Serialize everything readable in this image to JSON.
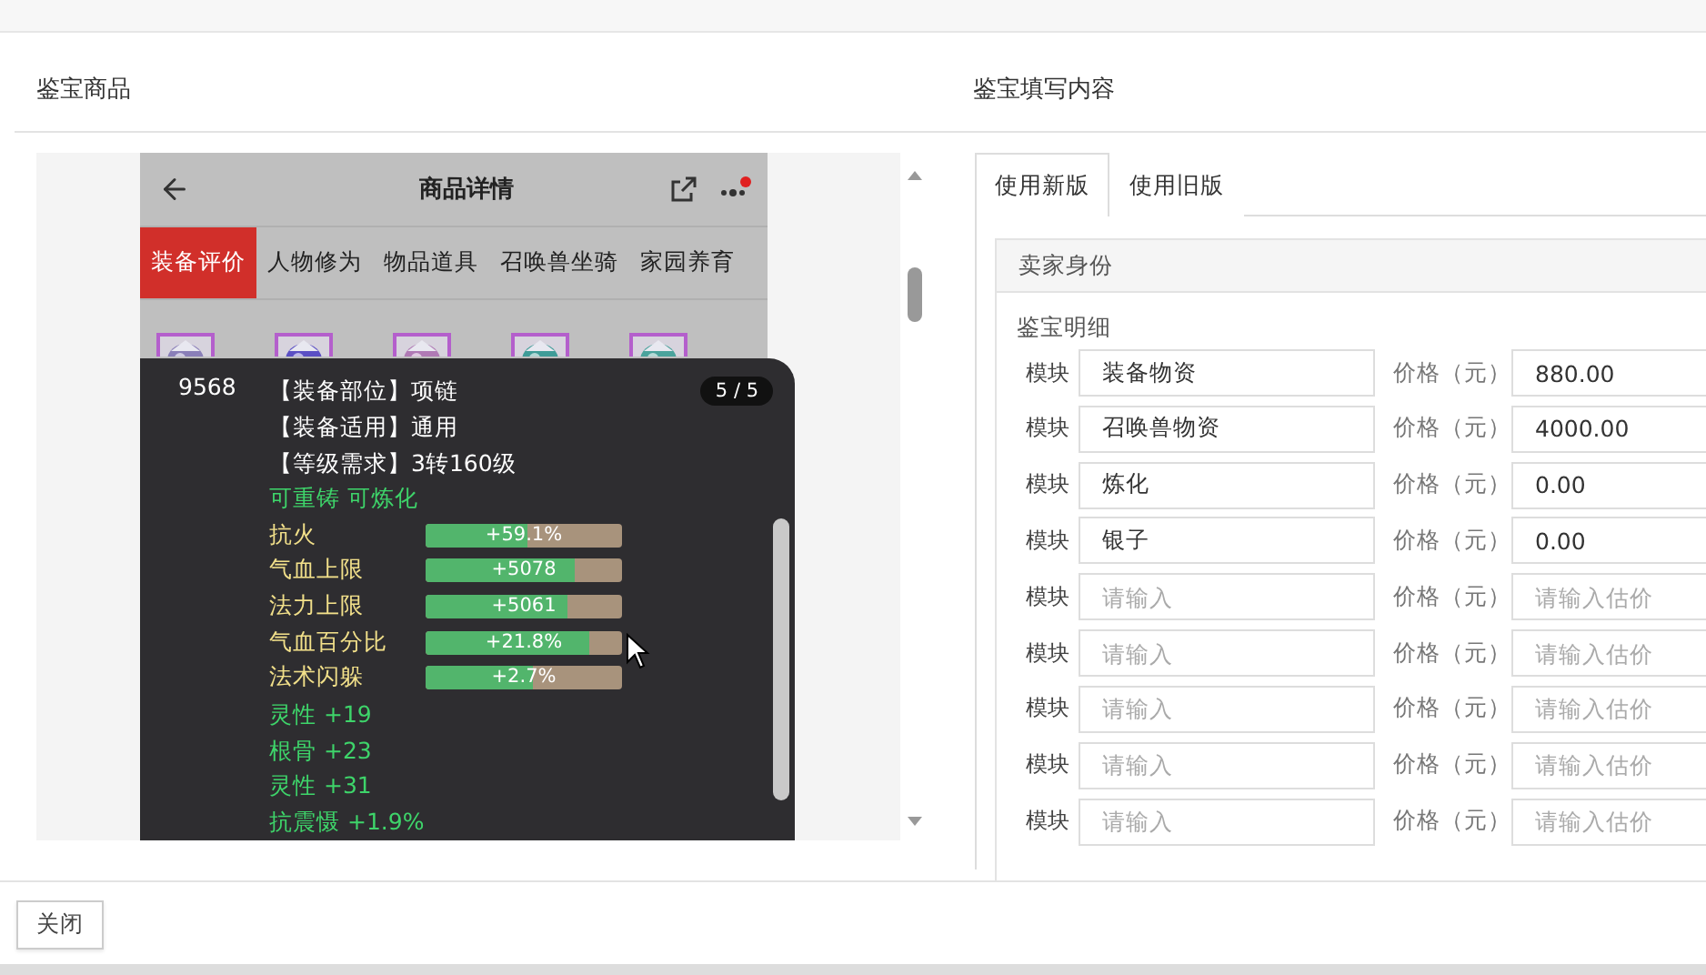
{
  "left_panel": {
    "title": "鉴宝商品",
    "screenshot": {
      "title": "商品详情",
      "tabs": [
        {
          "label": "装备评价",
          "selected": true
        },
        {
          "label": "人物修为",
          "selected": false
        },
        {
          "label": "物品道具",
          "selected": false
        },
        {
          "label": "召唤兽坐骑",
          "selected": false
        },
        {
          "label": "家园养育",
          "selected": false
        }
      ],
      "popup": {
        "id": "9568",
        "page": "5 / 5",
        "info": [
          "【装备部位】项链",
          "【装备适用】通用",
          "【等级需求】3转160级"
        ],
        "tags": "可重铸 可炼化",
        "stats": [
          {
            "label": "抗火",
            "value": "+59.1%",
            "level": 0.52
          },
          {
            "label": "气血上限",
            "value": "+5078",
            "level": 0.76
          },
          {
            "label": "法力上限",
            "value": "+5061",
            "level": 0.72
          },
          {
            "label": "气血百分比",
            "value": "+21.8%",
            "level": 0.83
          },
          {
            "label": "法术闪躲",
            "value": "+2.7%",
            "level": 0.55
          }
        ],
        "bonuses": [
          "灵性 +19",
          "根骨 +23",
          "灵性 +31",
          "抗震慑 +1.9%"
        ]
      }
    }
  },
  "right_panel": {
    "title": "鉴宝填写内容",
    "tabs": [
      {
        "label": "使用新版",
        "selected": true
      },
      {
        "label": "使用旧版",
        "selected": false
      }
    ],
    "section": "卖家身份",
    "subsection": "鉴宝明细",
    "rows": [
      {
        "label": "模块",
        "value": "装备物资",
        "price_label": "价格（元）",
        "price": "880.00"
      },
      {
        "label": "模块",
        "value": "召唤兽物资",
        "price_label": "价格（元）",
        "price": "4000.00"
      },
      {
        "label": "模块",
        "value": "炼化",
        "price_label": "价格（元）",
        "price": "0.00"
      },
      {
        "label": "模块",
        "value": "银子",
        "price_label": "价格（元）",
        "price": "0.00"
      },
      {
        "label": "模块",
        "placeholder": "请输入",
        "price_label": "价格（元）",
        "price_placeholder": "请输入估价"
      },
      {
        "label": "模块",
        "placeholder": "请输入",
        "price_label": "价格（元）",
        "price_placeholder": "请输入估价"
      },
      {
        "label": "模块",
        "placeholder": "请输入",
        "price_label": "价格（元）",
        "price_placeholder": "请输入估价"
      },
      {
        "label": "模块",
        "placeholder": "请输入",
        "price_label": "价格（元）",
        "price_placeholder": "请输入估价"
      },
      {
        "label": "模块",
        "placeholder": "请输入",
        "price_label": "价格（元）",
        "price_placeholder": "请输入估价"
      }
    ]
  },
  "footer": {
    "close": "关闭"
  }
}
